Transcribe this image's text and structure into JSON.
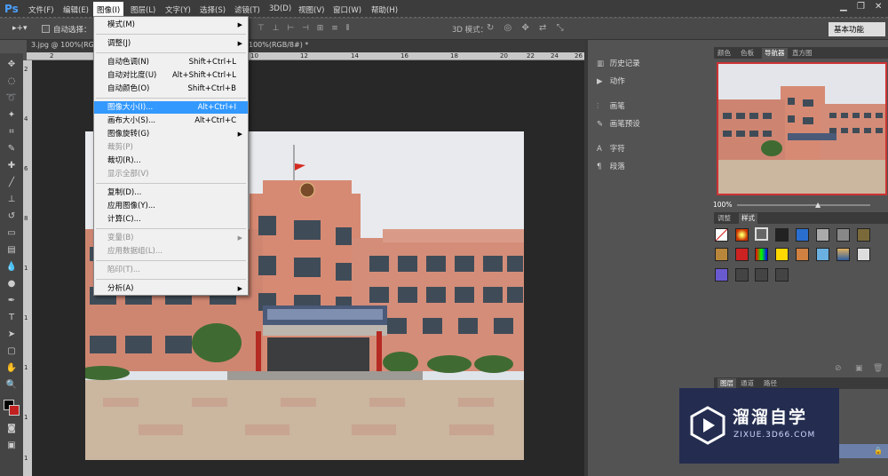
{
  "app": {
    "logo": "Ps"
  },
  "menubar": {
    "items": [
      "文件(F)",
      "编辑(E)",
      "图像(I)",
      "图层(L)",
      "文字(Y)",
      "选择(S)",
      "滤镜(T)",
      "3D(D)",
      "视图(V)",
      "窗口(W)",
      "帮助(H)"
    ],
    "active": "图像(I)"
  },
  "options_bar": {
    "auto_select_label": "自动选择：",
    "mode_3d_label": "3D 模式：",
    "workspace": "基本功能"
  },
  "document": {
    "tab_label": "3.jpg @ 100%(RGB",
    "tab2_label": "100%(RGB/8#) *",
    "ruler_top": [
      "2",
      "4",
      "6",
      "8",
      "10",
      "12",
      "14",
      "16",
      "18",
      "20",
      "22",
      "24",
      "26"
    ],
    "ruler_left": [
      "2",
      "4",
      "6",
      "8",
      "1",
      "1",
      "1",
      "1",
      "1"
    ]
  },
  "image_menu": {
    "items": [
      {
        "label": "模式(M)",
        "shortcut": "",
        "submenu": true,
        "disabled": false
      },
      {
        "sep": true
      },
      {
        "label": "调整(J)",
        "shortcut": "",
        "submenu": true,
        "disabled": false
      },
      {
        "sep": true
      },
      {
        "label": "自动色调(N)",
        "shortcut": "Shift+Ctrl+L",
        "submenu": false,
        "disabled": false
      },
      {
        "label": "自动对比度(U)",
        "shortcut": "Alt+Shift+Ctrl+L",
        "submenu": false,
        "disabled": false
      },
      {
        "label": "自动颜色(O)",
        "shortcut": "Shift+Ctrl+B",
        "submenu": false,
        "disabled": false
      },
      {
        "sep": true
      },
      {
        "label": "图像大小(I)...",
        "shortcut": "Alt+Ctrl+I",
        "submenu": false,
        "disabled": false,
        "selected": true
      },
      {
        "label": "画布大小(S)...",
        "shortcut": "Alt+Ctrl+C",
        "submenu": false,
        "disabled": false
      },
      {
        "label": "图像旋转(G)",
        "shortcut": "",
        "submenu": true,
        "disabled": false
      },
      {
        "label": "裁剪(P)",
        "shortcut": "",
        "submenu": false,
        "disabled": true
      },
      {
        "label": "裁切(R)...",
        "shortcut": "",
        "submenu": false,
        "disabled": false
      },
      {
        "label": "显示全部(V)",
        "shortcut": "",
        "submenu": false,
        "disabled": true
      },
      {
        "sep": true
      },
      {
        "label": "复制(D)...",
        "shortcut": "",
        "submenu": false,
        "disabled": false
      },
      {
        "label": "应用图像(Y)...",
        "shortcut": "",
        "submenu": false,
        "disabled": false
      },
      {
        "label": "计算(C)...",
        "shortcut": "",
        "submenu": false,
        "disabled": false
      },
      {
        "sep": true
      },
      {
        "label": "变量(B)",
        "shortcut": "",
        "submenu": true,
        "disabled": true
      },
      {
        "label": "应用数据组(L)...",
        "shortcut": "",
        "submenu": false,
        "disabled": true
      },
      {
        "sep": true
      },
      {
        "label": "陷印(T)...",
        "shortcut": "",
        "submenu": false,
        "disabled": true
      },
      {
        "sep": true
      },
      {
        "label": "分析(A)",
        "shortcut": "",
        "submenu": true,
        "disabled": false
      }
    ]
  },
  "mid_panel": {
    "items": [
      {
        "label": "历史记录",
        "icon": "history-icon"
      },
      {
        "label": "动作",
        "icon": "play-icon"
      },
      {
        "label": "画笔",
        "icon": "brush-icon"
      },
      {
        "label": "画笔预设",
        "icon": "brush-preset-icon"
      },
      {
        "label": "字符",
        "icon": "character-icon"
      },
      {
        "label": "段落",
        "icon": "paragraph-icon"
      }
    ]
  },
  "right_panel": {
    "top_tabs": [
      "颜色",
      "色板",
      "导航器",
      "直方图"
    ],
    "top_active": "导航器",
    "zoom": "100%",
    "mid_tabs": [
      "调整",
      "样式"
    ],
    "mid_active": "样式",
    "layers_tabs": [
      "图层",
      "通道",
      "路径"
    ],
    "layers_active": "图层"
  },
  "watermark": {
    "title": "溜溜自学",
    "url": "ZIXUE.3D66.COM"
  },
  "colors": {
    "menu_highlight": "#3399ff",
    "fg_swatch": "#000000",
    "bg_swatch": "#c0201f"
  }
}
